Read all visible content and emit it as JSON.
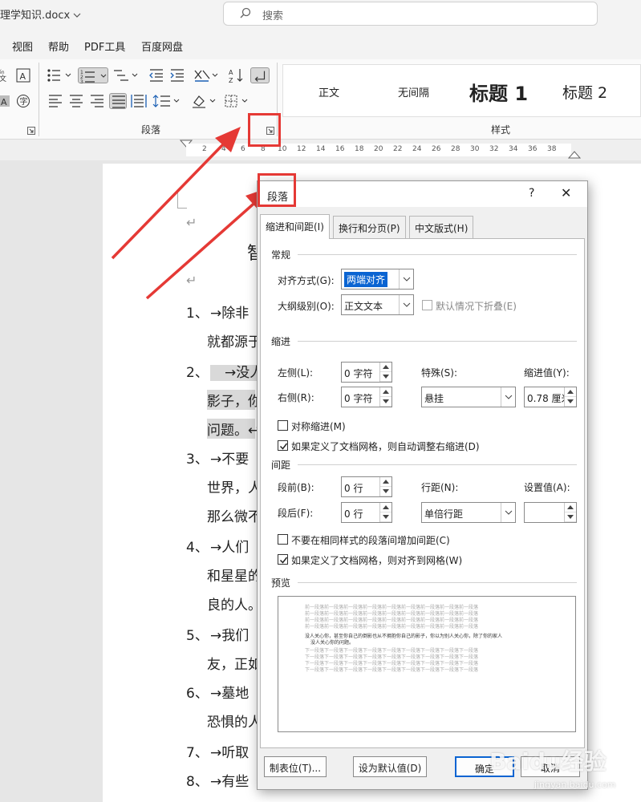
{
  "window": {
    "title": "理学知识.docx",
    "search_label": "搜索"
  },
  "menu_tabs": [
    "视图",
    "帮助",
    "PDF工具",
    "百度网盘"
  ],
  "ribbon": {
    "paragraph_group_label": "段落",
    "styles_group_label": "样式",
    "styles": [
      "正文",
      "无间隔",
      "标题 1",
      "标题 2"
    ]
  },
  "ruler": {
    "ticks": [
      "2",
      "4",
      "6",
      "8",
      "10",
      "12",
      "14",
      "16",
      "18",
      "20",
      "22",
      "24",
      "26",
      "28",
      "30",
      "32",
      "34",
      "36",
      "38"
    ]
  },
  "document": {
    "heading_partial": "智",
    "items": [
      {
        "num": "1、",
        "line1": "→除非",
        "line2": "就都源于"
      },
      {
        "num": "2、",
        "line1": "→没人",
        "line2": "影子，你",
        "line3": "问题。↩"
      },
      {
        "num": "3、",
        "line1": "→不要",
        "line2": "世界，人",
        "line3": "那么微不"
      },
      {
        "num": "4、",
        "line1": "→人们",
        "line2": "和星星的",
        "line3": "良的人。"
      },
      {
        "num": "5、",
        "line1": "→我们",
        "line2": "友，正如"
      },
      {
        "num": "6、",
        "line1": "→墓地",
        "line2": "恐惧的人"
      },
      {
        "num": "7、",
        "line1": "→听取"
      },
      {
        "num": "8、",
        "line1": "→有些"
      }
    ]
  },
  "dialog": {
    "title": "段落",
    "help": "?",
    "close": "✕",
    "tabs": [
      "缩进和间距(I)",
      "换行和分页(P)",
      "中文版式(H)"
    ],
    "general": {
      "section": "常规",
      "alignment_label": "对齐方式(G):",
      "alignment_value": "两端对齐",
      "outline_label": "大纲级别(O):",
      "outline_value": "正文文本",
      "collapse_label": "默认情况下折叠(E)"
    },
    "indent": {
      "section": "缩进",
      "left_label": "左侧(L):",
      "left_value": "0 字符",
      "right_label": "右侧(R):",
      "right_value": "0 字符",
      "special_label": "特殊(S):",
      "special_value": "悬挂",
      "by_label": "缩进值(Y):",
      "by_value": "0.78 厘米",
      "mirror_label": "对称缩进(M)",
      "auto_adjust_label": "如果定义了文档网格，则自动调整右缩进(D)"
    },
    "spacing": {
      "section": "间距",
      "before_label": "段前(B):",
      "before_value": "0 行",
      "after_label": "段后(F):",
      "after_value": "0 行",
      "line_label": "行距(N):",
      "line_value": "单倍行距",
      "at_label": "设置值(A):",
      "at_value": "",
      "no_space_label": "不要在相同样式的段落间增加间距(C)",
      "snap_grid_label": "如果定义了文档网格，则对齐到网格(W)"
    },
    "preview": {
      "section": "预览",
      "prev_text": "前一段落前一段落前一段落前一段落前一段落前一段落前一段落前一段落前一段落",
      "cur_text_1": "没人关心你，甚至你自己的倒影也从不拥抱你自己的影子，你以为别人关心你，除了你的家人",
      "cur_text_2": "没人关心你的问题。",
      "next_text": "下一段落下一段落下一段落下一段落下一段落下一段落下一段落下一段落下一段落"
    },
    "buttons": {
      "tabs": "制表位(T)...",
      "default": "设为默认值(D)",
      "ok": "确定",
      "cancel": "取消"
    }
  },
  "watermark": {
    "text": "Baidu经验",
    "sub": "jingyan.baidu.com"
  },
  "colors": {
    "accent": "#0a64d2",
    "annotation_red": "#e53935"
  }
}
